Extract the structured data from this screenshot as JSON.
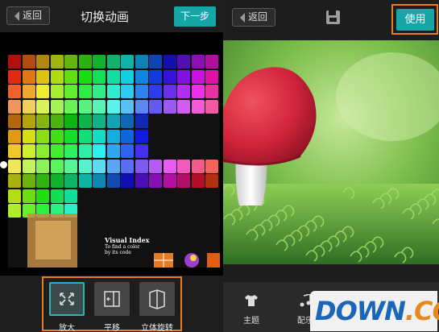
{
  "left_panel": {
    "back_label": "返回",
    "title": "切换动画",
    "next_label": "下一步",
    "chart_caption_title": "Visual Index",
    "chart_caption_sub": "To find a color by its code",
    "tools": [
      {
        "name": "zoom",
        "label": "放大",
        "icon": "zoom-expand-icon",
        "selected": true
      },
      {
        "name": "pan",
        "label": "平移",
        "icon": "pan-slide-icon",
        "selected": false
      },
      {
        "name": "rotate3d",
        "label": "立体旋转",
        "icon": "cube-rotate-icon",
        "selected": false
      }
    ]
  },
  "right_panel": {
    "back_label": "返回",
    "save_icon": "save-icon",
    "use_label": "使用",
    "tabs": [
      {
        "label": "主题",
        "icon": "shirt-icon"
      },
      {
        "label": "配乐",
        "icon": "music-icon"
      }
    ]
  },
  "watermark": {
    "text_main": "DOWN",
    "text_dot": ".",
    "text_suffix": "CC"
  },
  "colors": {
    "accent": "#17a6a8",
    "highlight_border": "#e57b22",
    "dark_bg": "#1e1e1e",
    "mushroom_cap": "#d0243a",
    "moss_green": "#5aa03a"
  }
}
